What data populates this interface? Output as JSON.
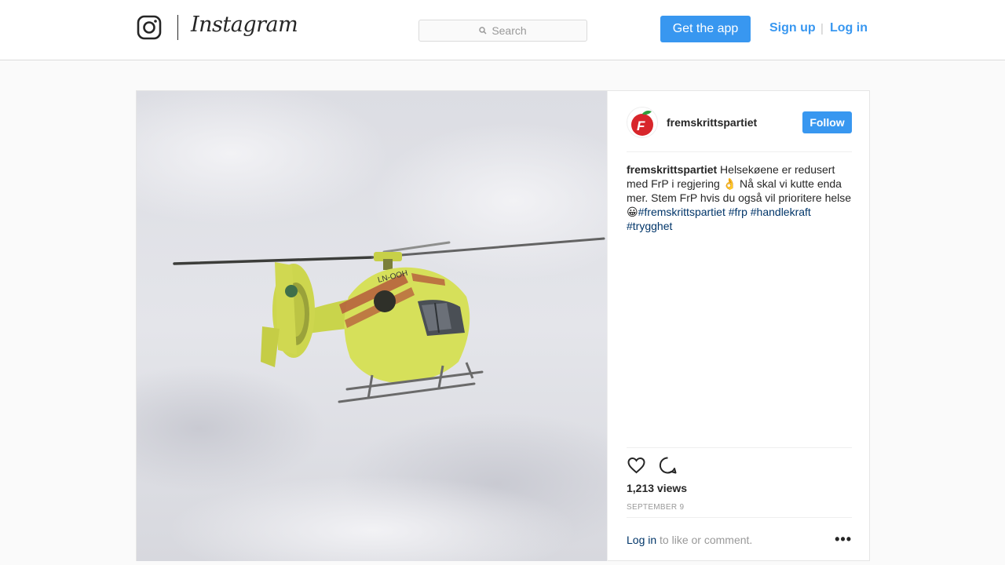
{
  "header": {
    "wordmark": "Instagram",
    "search_placeholder": "Search",
    "get_app_label": "Get the app",
    "signup_label": "Sign up",
    "separator": "|",
    "login_label": "Log in"
  },
  "post": {
    "media_alt": "helicopter-video",
    "aircraft_registration": "LN-OOH",
    "author": {
      "username": "fremskrittspartiet",
      "follow_label": "Follow"
    },
    "caption": {
      "username": "fremskrittspartiet",
      "text": "Helsekøene er redusert med FrP i regjering 👌 Nå skal vi kutte enda mer. Stem FrP hvis du også vil prioritere helse 😀",
      "hashtags": [
        "#fremskrittspartiet",
        "#frp",
        "#handlekraft",
        "#trygghet"
      ]
    },
    "views": "1,213 views",
    "date": "SEPTEMBER 9",
    "login_cta": {
      "link_label": "Log in",
      "rest": " to like or comment."
    },
    "more_label": "•••"
  },
  "colors": {
    "accent": "#3897f0",
    "hashtag": "#003569",
    "border": "#dbdbdb",
    "background": "#fafafa",
    "helicopter_yellow": "#d8e35a"
  }
}
